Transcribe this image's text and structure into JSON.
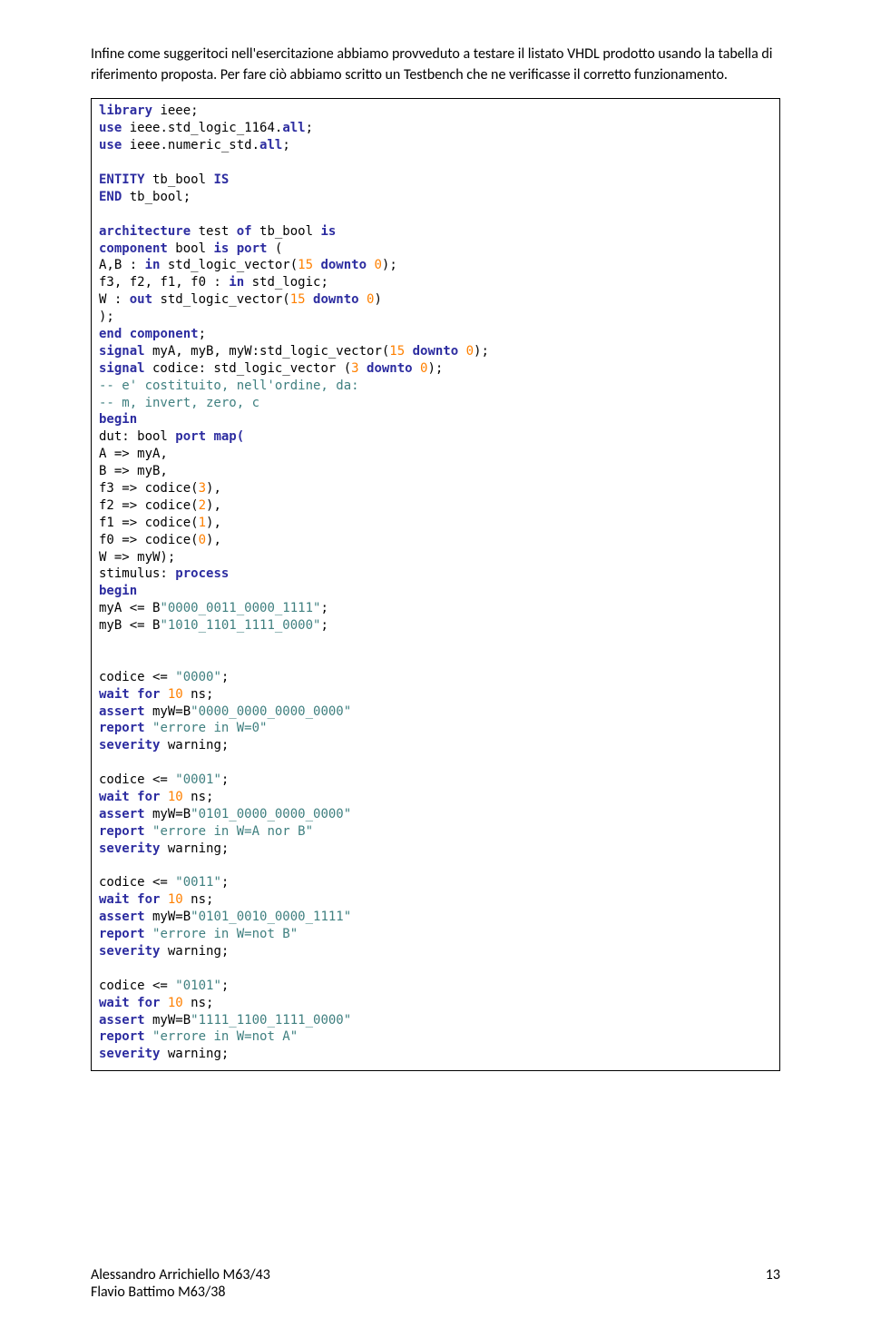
{
  "intro": {
    "p1": "Infine come suggeritoci nell'esercitazione abbiamo provveduto a testare il listato VHDL prodotto usando la tabella di riferimento proposta. Per fare ciò abbiamo scritto un Testbench che ne verificasse il corretto funzionamento."
  },
  "code": {
    "l1_library": "library",
    "l1_ieee": " ieee;",
    "l2_use": "use",
    "l2_rest": " ieee.std_logic_1164.",
    "l2_all": "all",
    "l3_use": "use",
    "l3_rest": " ieee.numeric_std.",
    "l3_all": "all",
    "l5_entity": "ENTITY",
    "l5_name": " tb_bool ",
    "l5_is": "IS",
    "l6_end": "END",
    "l6_name": " tb_bool;",
    "l8_arch": "architecture",
    "l8_test": " test ",
    "l8_of": "of",
    "l8_tb": " tb_bool ",
    "l8_is": "is",
    "l9_comp": "component",
    "l9_bool": " bool ",
    "l9_is": "is",
    "l9_port": " port",
    "l9_open": " (",
    "l10_ab": "A,B : ",
    "l10_in": "in",
    "l10_slv": " std_logic_vector(",
    "l10_15": "15",
    "l10_downto": " downto ",
    "l10_0": "0",
    "l10_close": ");",
    "l11_f": "f3, f2, f1, f0 : ",
    "l11_in": "in",
    "l11_sl": " std_logic;",
    "l12_w": "W : ",
    "l12_out": "out",
    "l12_slv": " std_logic_vector(",
    "l12_15": "15",
    "l12_downto": " downto ",
    "l12_0": "0",
    "l12_close": ")",
    "l13": ");",
    "l14_end": "end",
    "l14_comp": " component",
    "l15_signal": "signal",
    "l15_names": " myA, myB, myW:std_logic_vector(",
    "l15_15": "15",
    "l15_downto": " downto ",
    "l15_0": "0",
    "l15_close": ");",
    "l16_signal": "signal",
    "l16_cod": " codice: std_logic_vector (",
    "l16_3": "3",
    "l16_downto": " downto ",
    "l16_0": "0",
    "l16_close": ");",
    "l17": "-- e' costituito, nell'ordine, da:",
    "l18": "-- m, invert, zero, c",
    "l19_begin": "begin",
    "l20_dut": "dut: bool ",
    "l20_portmap": "port map(",
    "l21": "A => myA,",
    "l22": "B => myB,",
    "l23_a": "f3 => codice(",
    "l23_n": "3",
    "l23_b": "),",
    "l24_a": "f2 => codice(",
    "l24_n": "2",
    "l24_b": "),",
    "l25_a": "f1 => codice(",
    "l25_n": "1",
    "l25_b": "),",
    "l26_a": "f0 => codice(",
    "l26_n": "0",
    "l26_b": "),",
    "l27": "W => myW);",
    "l28_stim": "stimulus: ",
    "l28_proc": "process",
    "l29_begin": "begin",
    "l30_a": "myA <= B",
    "l30_s": "\"0000_0011_0000_1111\"",
    "l31_a": "myB <= B",
    "l31_s": "\"1010_1101_1111_0000\"",
    "b1_c": "codice <= ",
    "b1_s": "\"0000\"",
    "wait": "wait",
    "for": " for ",
    "ten": "10",
    "ns": " ns;",
    "b1_as": "assert",
    "b1_myw": " myW=B",
    "b1_sv": "\"0000_0000_0000_0000\"",
    "b1_rep": "report ",
    "b1_rs": "\"errore in W=0\"",
    "sev": "severity",
    "warn": " warning;",
    "b2_c": "codice <= ",
    "b2_s": "\"0001\"",
    "b2_sv": "\"0101_0000_0000_0000\"",
    "b2_rs": "\"errore in W=A nor B\"",
    "b3_c": "codice <= ",
    "b3_s": "\"0011\"",
    "b3_sv": "\"0101_0010_0000_1111\"",
    "b3_rs": "\"errore in W=not B\"",
    "b4_c": "codice <= ",
    "b4_s": "\"0101\"",
    "b4_sv": "\"1111_1100_1111_0000\"",
    "b4_rs": "\"errore in W=not A\"",
    "semi": ";"
  },
  "footer": {
    "name1": "Alessandro Arrichiello M63/43",
    "name2": "Flavio Battimo M63/38",
    "page": "13"
  }
}
